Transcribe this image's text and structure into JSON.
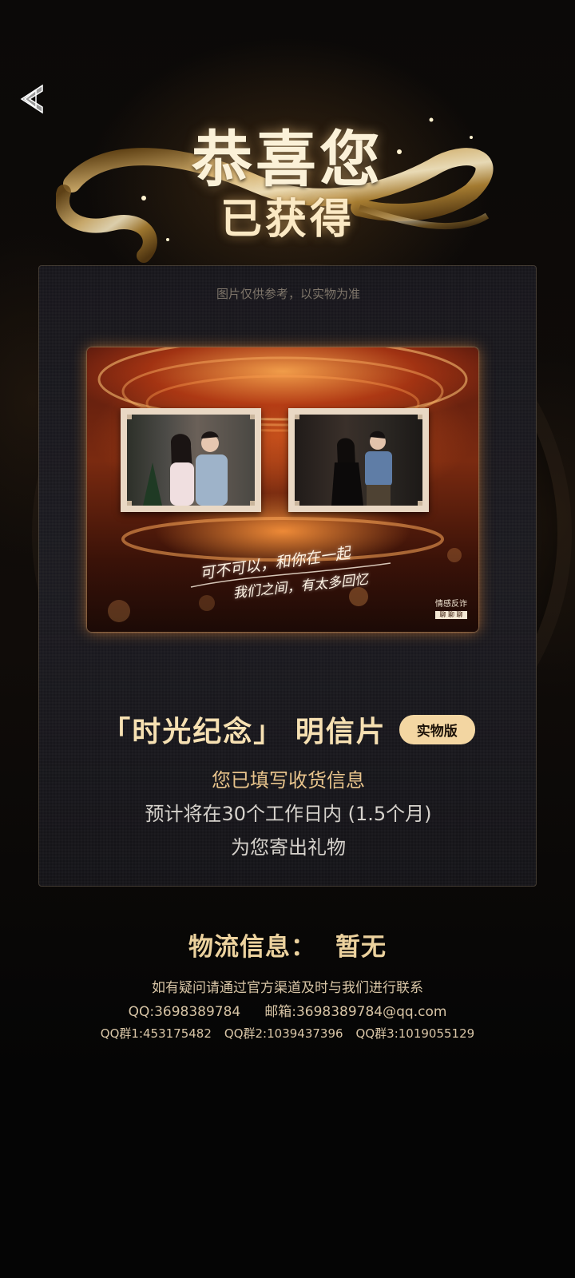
{
  "header": {
    "back_icon": "chevron-left-icon",
    "title": "恭喜您",
    "subtitle": "已获得"
  },
  "card": {
    "disclaimer": "图片仅供参考，以实物为准",
    "postcard": {
      "handwriting_line1": "可不可以，和你在一起",
      "handwriting_line2": "我们之间，有太多回忆",
      "logo_text": "情感反诈",
      "logo_tag": "聊 聊 聊"
    },
    "prize_name": "「时光纪念」 明信片",
    "prize_badge": "实物版",
    "status_line1": "您已填写收货信息",
    "status_line2": "预计将在30个工作日内 (1.5个月)",
    "status_line3": "为您寄出礼物"
  },
  "logistics": {
    "label": "物流信息：",
    "value": "暂无"
  },
  "contact": {
    "note": "如有疑问请通过官方渠道及时与我们进行联系",
    "qq": "QQ:3698389784",
    "email": "邮箱:3698389784@qq.com",
    "group1": "QQ群1:453175482",
    "group2": "QQ群2:1039437396",
    "group3": "QQ群3:1019055129"
  },
  "colors": {
    "accent_gold": "#f3d6a2",
    "background": "#050505"
  }
}
